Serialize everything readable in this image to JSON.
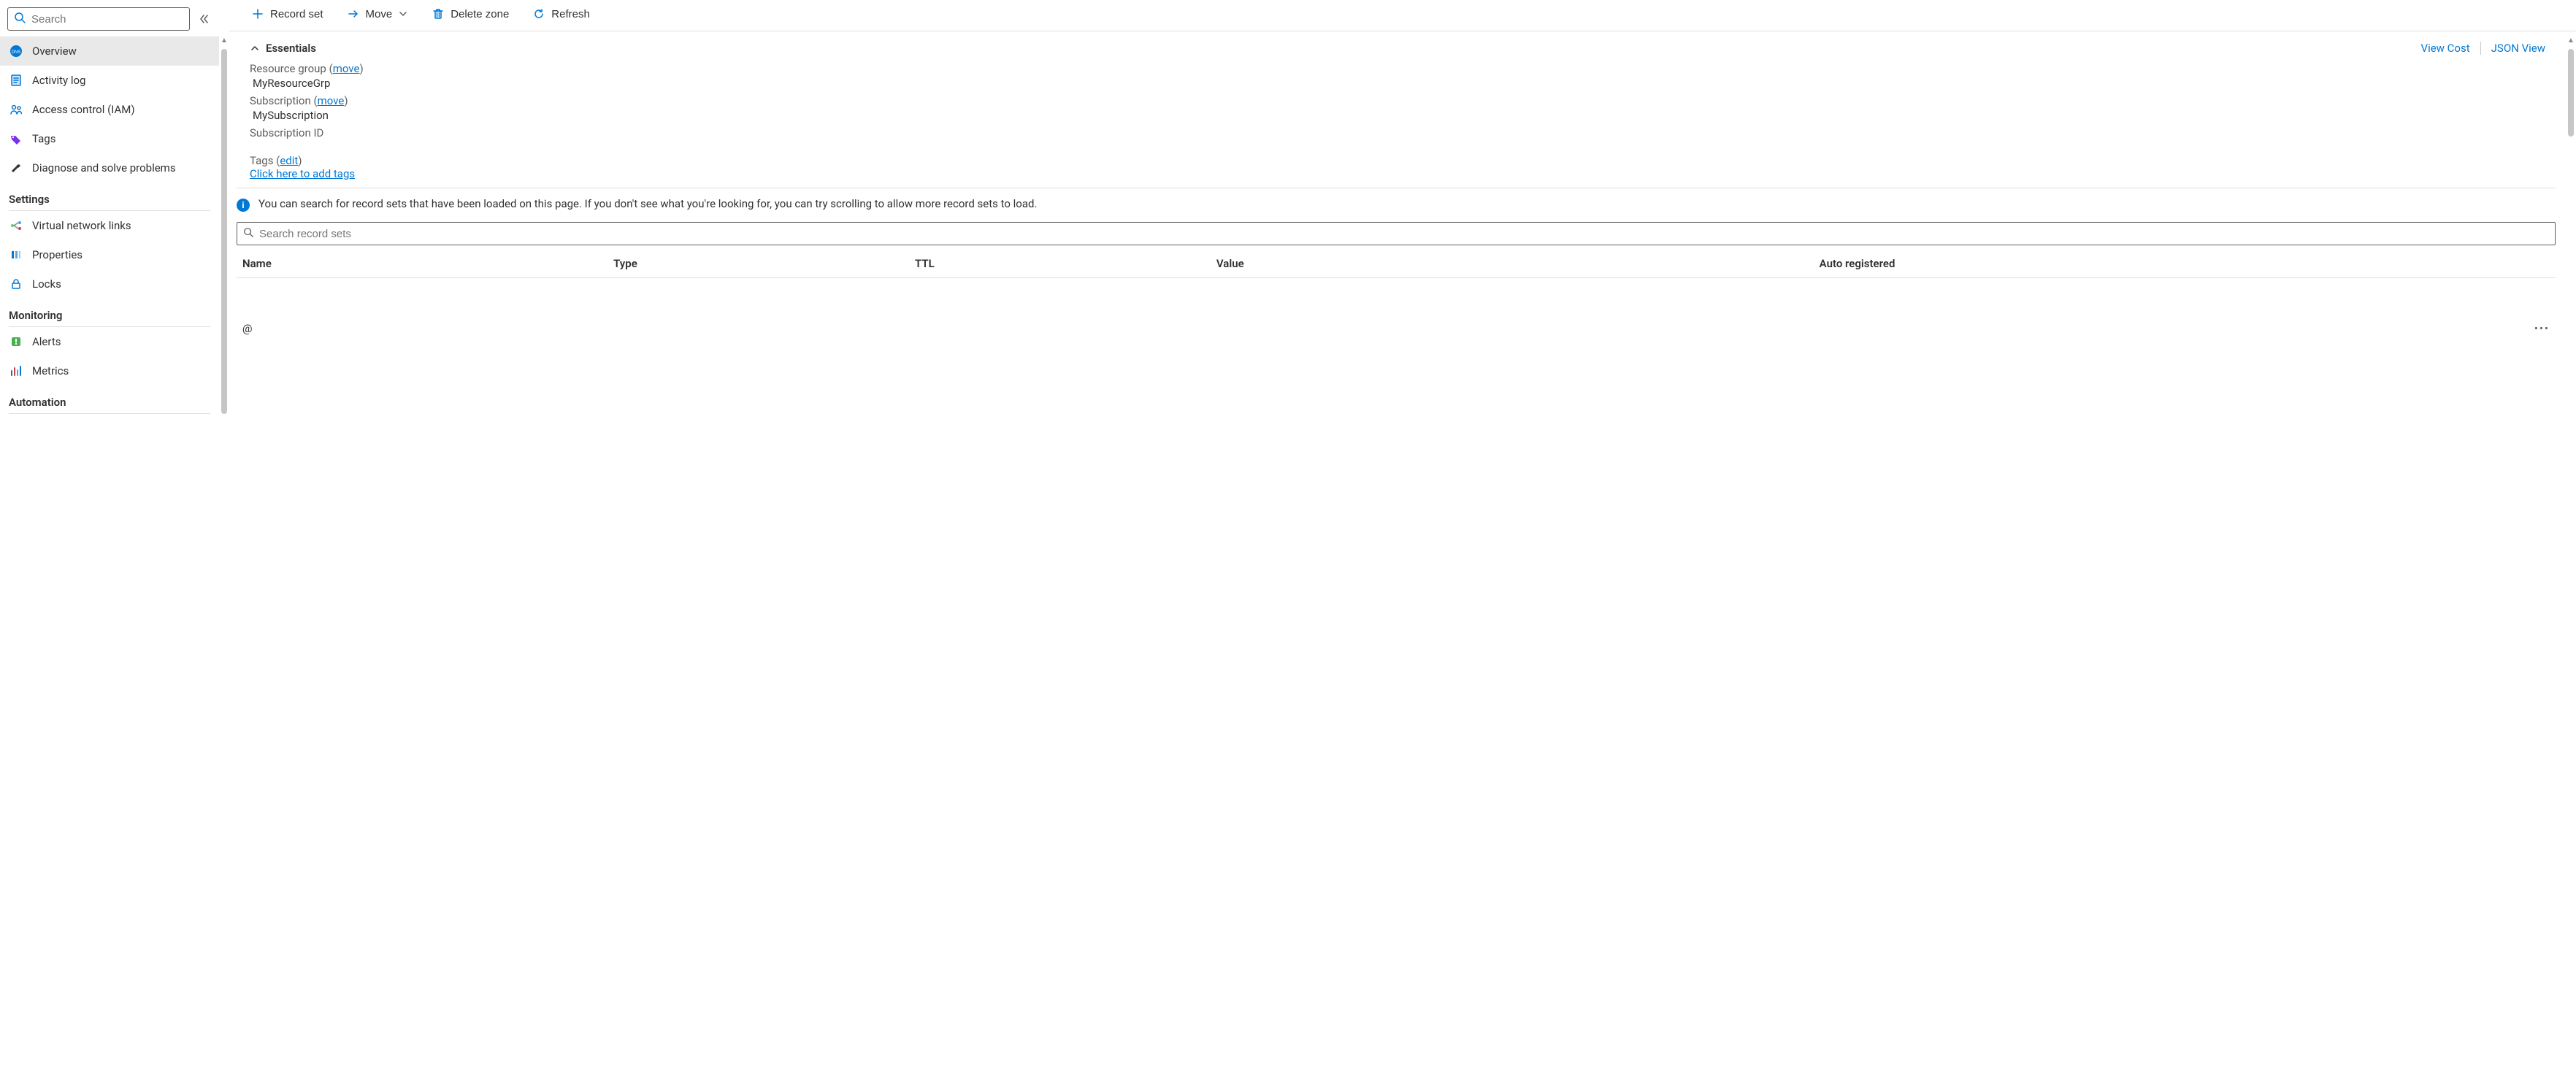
{
  "sidebar": {
    "search_placeholder": "Search",
    "items": [
      {
        "label": "Overview"
      },
      {
        "label": "Activity log"
      },
      {
        "label": "Access control (IAM)"
      },
      {
        "label": "Tags"
      },
      {
        "label": "Diagnose and solve problems"
      }
    ],
    "sections": {
      "settings": {
        "title": "Settings",
        "items": [
          {
            "label": "Virtual network links"
          },
          {
            "label": "Properties"
          },
          {
            "label": "Locks"
          }
        ]
      },
      "monitoring": {
        "title": "Monitoring",
        "items": [
          {
            "label": "Alerts"
          },
          {
            "label": "Metrics"
          }
        ]
      },
      "automation": {
        "title": "Automation"
      }
    }
  },
  "toolbar": {
    "record_set": "Record set",
    "move": "Move",
    "delete_zone": "Delete zone",
    "refresh": "Refresh"
  },
  "essentials": {
    "header": "Essentials",
    "view_cost": "View Cost",
    "json_view": "JSON View",
    "resource_group_label": "Resource group",
    "resource_group_move": "move",
    "resource_group_value": "MyResourceGrp",
    "subscription_label": "Subscription",
    "subscription_move": "move",
    "subscription_value": "MySubscription",
    "subscription_id_label": "Subscription ID",
    "tags_label": "Tags",
    "tags_edit": "edit",
    "tags_add_link": "Click here to add tags"
  },
  "info_text": "You can search for record sets that have been loaded on this page. If you don't see what you're looking for, you can try scrolling to allow more record sets to load.",
  "records": {
    "search_placeholder": "Search record sets",
    "columns": {
      "name": "Name",
      "type": "Type",
      "ttl": "TTL",
      "value": "Value",
      "auto_registered": "Auto registered"
    },
    "rows": [
      {
        "name": "@",
        "type": "",
        "ttl": "",
        "value": "",
        "auto_registered": ""
      }
    ]
  }
}
